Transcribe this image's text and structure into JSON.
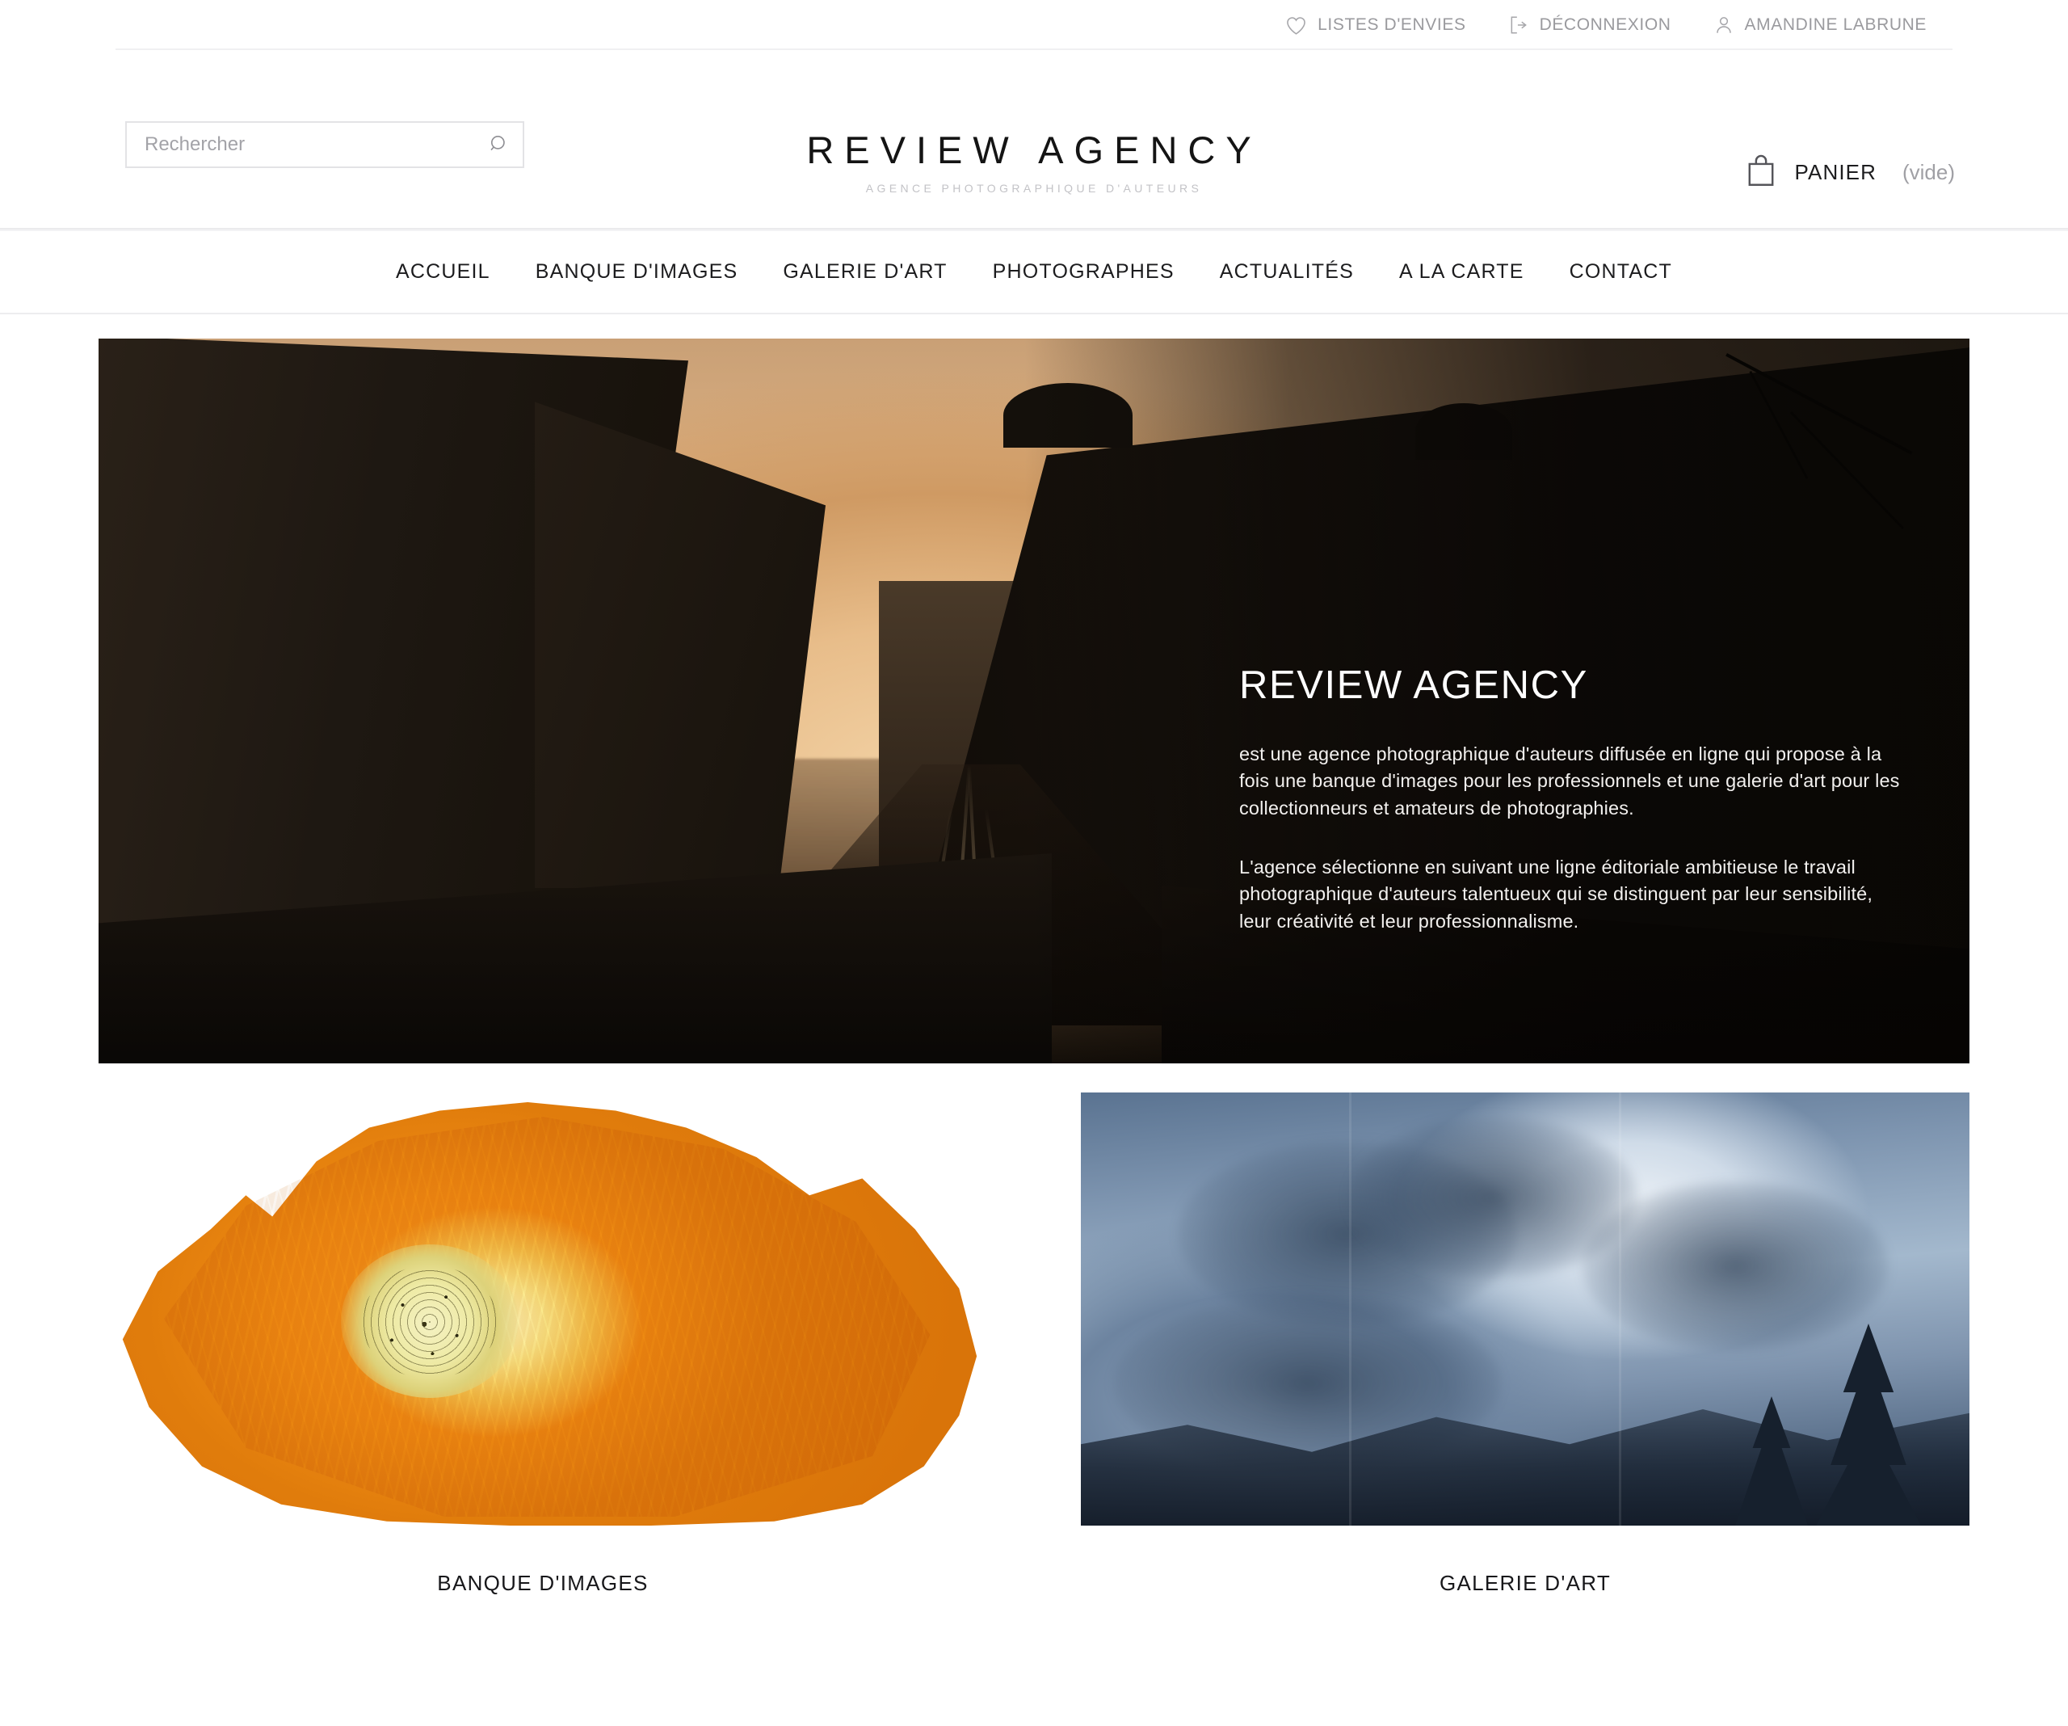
{
  "topbar": {
    "links": [
      {
        "label": "LISTES D'ENVIES",
        "icon": "heart-icon"
      },
      {
        "label": "DÉCONNEXION",
        "icon": "logout-icon"
      },
      {
        "label": "AMANDINE LABRUNE",
        "icon": "user-icon"
      }
    ]
  },
  "search": {
    "placeholder": "Rechercher",
    "value": "",
    "icon": "search-icon"
  },
  "logo": {
    "title": "REVIEW AGENCY",
    "tagline": "AGENCE PHOTOGRAPHIQUE D'AUTEURS"
  },
  "cart": {
    "icon": "shopping-bag-icon",
    "label": "PANIER",
    "count": "(vide)"
  },
  "nav": {
    "items": [
      {
        "label": "ACCUEIL"
      },
      {
        "label": "BANQUE D'IMAGES"
      },
      {
        "label": "GALERIE D'ART"
      },
      {
        "label": "PHOTOGRAPHES"
      },
      {
        "label": "ACTUALITÉS"
      },
      {
        "label": "A LA CARTE"
      },
      {
        "label": "CONTACT"
      }
    ]
  },
  "hero": {
    "title": "REVIEW AGENCY",
    "paragraph1": "est une agence photographique d'auteurs diffusée en ligne qui propose à la fois une banque d'images pour les professionnels et une galerie d'art pour les collectionneurs et amateurs de photographies.",
    "paragraph2": "L'agence sélectionne en suivant une ligne éditoriale ambitieuse le travail photographique d'auteurs talentueux qui se distinguent par leur sensibilité, leur créativité et leur professionnalisme.",
    "image_alt": "Vue urbaine parisienne au coucher du soleil avec voie ferrée"
  },
  "cards": [
    {
      "caption": "BANQUE D'IMAGES",
      "image_alt": "Gros plan d'un pavot orange sur fond blanc"
    },
    {
      "caption": "GALERIE D'ART",
      "image_alt": "Ciel nuageux bleu au-dessus d'arbres et de montagnes"
    }
  ],
  "colors": {
    "text_primary": "#1c1c1e",
    "text_muted": "#9a9a9e",
    "border": "#e3e3e6",
    "background": "#ffffff",
    "hero_overlay": "#080604"
  }
}
